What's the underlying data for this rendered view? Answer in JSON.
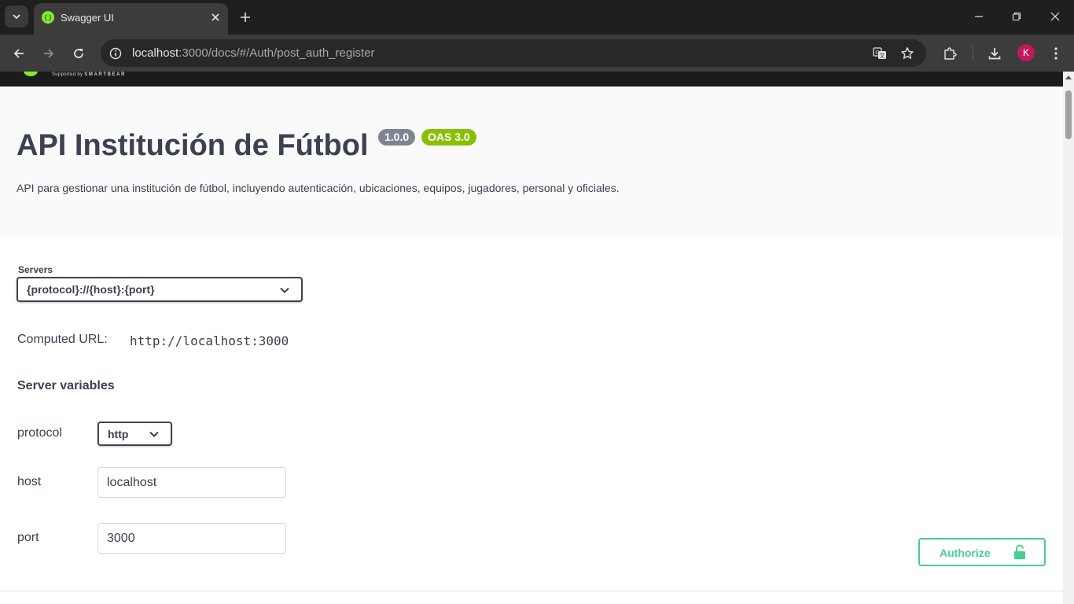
{
  "browser": {
    "tab_title": "Swagger UI",
    "url_host": "localhost",
    "url_rest": ":3000/docs/#/Auth/post_auth_register",
    "profile_initial": "K",
    "icons": [
      "tab-list-icon",
      "favicon-icon",
      "close-icon",
      "plus-icon",
      "minimize-icon",
      "restore-icon",
      "close-window-icon",
      "back-icon",
      "forward-icon",
      "reload-icon",
      "site-info-icon",
      "translate-icon",
      "star-icon",
      "extensions-icon",
      "download-icon",
      "more-icon"
    ]
  },
  "topbar": {
    "supported_by": "Supported by",
    "brand": "SMARTBEAR"
  },
  "info": {
    "title": "API Institución de Fútbol",
    "version_badge": "1.0.0",
    "oas_badge": "OAS 3.0",
    "description": "API para gestionar una institución de fútbol, incluyendo autenticación, ubicaciones, equipos, jugadores, personal y oficiales."
  },
  "servers": {
    "label": "Servers",
    "selected": "{protocol}://{host}:{port}",
    "computed_label": "Computed URL:",
    "computed_url": "http://localhost:3000",
    "variables_heading": "Server variables",
    "variables": {
      "protocol": {
        "label": "protocol",
        "value": "http"
      },
      "host": {
        "label": "host",
        "value": "localhost"
      },
      "port": {
        "label": "port",
        "value": "3000"
      }
    }
  },
  "authorize": {
    "label": "Authorize"
  },
  "colors": {
    "accent_green": "#49cc90",
    "text": "#3b4151",
    "oas_badge": "#89bf04",
    "version_badge": "#7d8492"
  }
}
